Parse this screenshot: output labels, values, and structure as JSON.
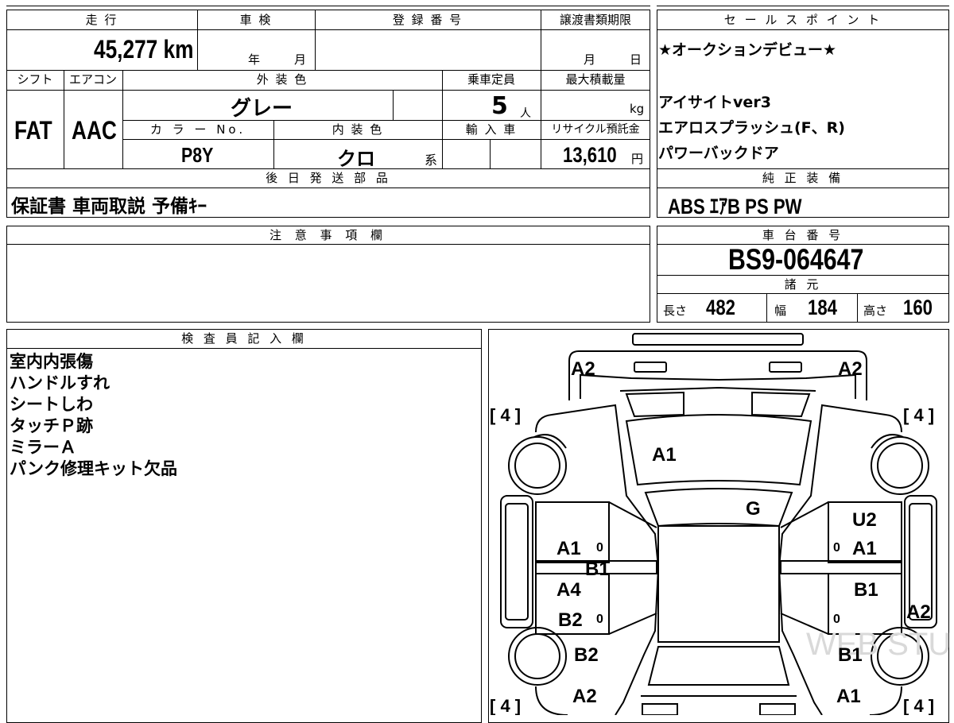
{
  "vehicle_info": {
    "mileage_label": "走 行",
    "mileage_value": "45,277 km",
    "inspection_label": "車 検",
    "inspection_year_unit": "年",
    "inspection_month_unit": "月",
    "registration_label": "登 録 番 号",
    "transfer_deadline_label": "譲渡書類期限",
    "transfer_month_unit": "月",
    "transfer_day_unit": "日",
    "shift_label": "シフト",
    "shift_value": "FAT",
    "aircon_label": "エアコン",
    "aircon_value": "AAC",
    "exterior_color_label": "外 装 色",
    "exterior_color_value": "グレー",
    "capacity_label": "乗車定員",
    "capacity_value": "5",
    "capacity_unit": "人",
    "max_load_label": "最大積載量",
    "max_load_unit": "kg",
    "color_no_label": "カ ラ ー No.",
    "color_no_value": "P8Y",
    "interior_color_label": "内 装 色",
    "interior_color_value": "クロ",
    "interior_color_suffix": "系",
    "import_label": "輸 入 車",
    "recycle_label": "リサイクル預託金",
    "recycle_value": "13,610",
    "recycle_unit": "円",
    "later_parts_label": "後 日 発 送 部 品",
    "later_parts_value": "保証書 車両取説 予備ｷｰ"
  },
  "sales_points": {
    "label": "セ ー ル ス ポ イ ン ト",
    "lines": [
      "★オークションデビュー★",
      "",
      "アイサイトver3",
      "エアロスプラッシュ(F、R)",
      "パワーバックドア"
    ]
  },
  "genuine_equipment": {
    "label": "純 正 装 備",
    "value": "ABS ｴｱB PS PW"
  },
  "notes": {
    "label": "注 意 事 項 欄"
  },
  "chassis": {
    "label": "車 台 番 号",
    "value": "BS9-064647",
    "specs_label": "諸 元",
    "length_label": "長さ",
    "length_value": "482",
    "width_label": "幅",
    "width_value": "184",
    "height_label": "高さ",
    "height_value": "160"
  },
  "inspector": {
    "label": "検 査 員 記 入 欄",
    "lines": [
      "室内内張傷",
      "ハンドルすれ",
      "シートしわ",
      "タッチＰ跡",
      "ミラーＡ",
      "パンク修理キット欠品"
    ]
  },
  "diagram": {
    "marks": {
      "front_left_corner": "A2",
      "front_right_corner": "A2",
      "windshield": "A1",
      "roof": "G",
      "left_front_door": "A1",
      "left_front_door_2": "B1",
      "left_rear_door_1": "A4",
      "left_rear_door_2": "B2",
      "left_rear_fender": "B2",
      "left_rear_corner": "A2",
      "right_front_door_1": "U2",
      "right_front_door_2": "A1",
      "right_rear_door": "B1",
      "right_side": "A2",
      "right_rear_fender": "B1",
      "right_rear_corner": "A1"
    },
    "tire_marks": {
      "front_left": "[ 4 ]",
      "front_right": "[ 4 ]",
      "rear_left": "[ 4 ]",
      "rear_right": "[ 4 ]"
    },
    "small_zero": "0",
    "watermark": "WEB STUDIO"
  }
}
